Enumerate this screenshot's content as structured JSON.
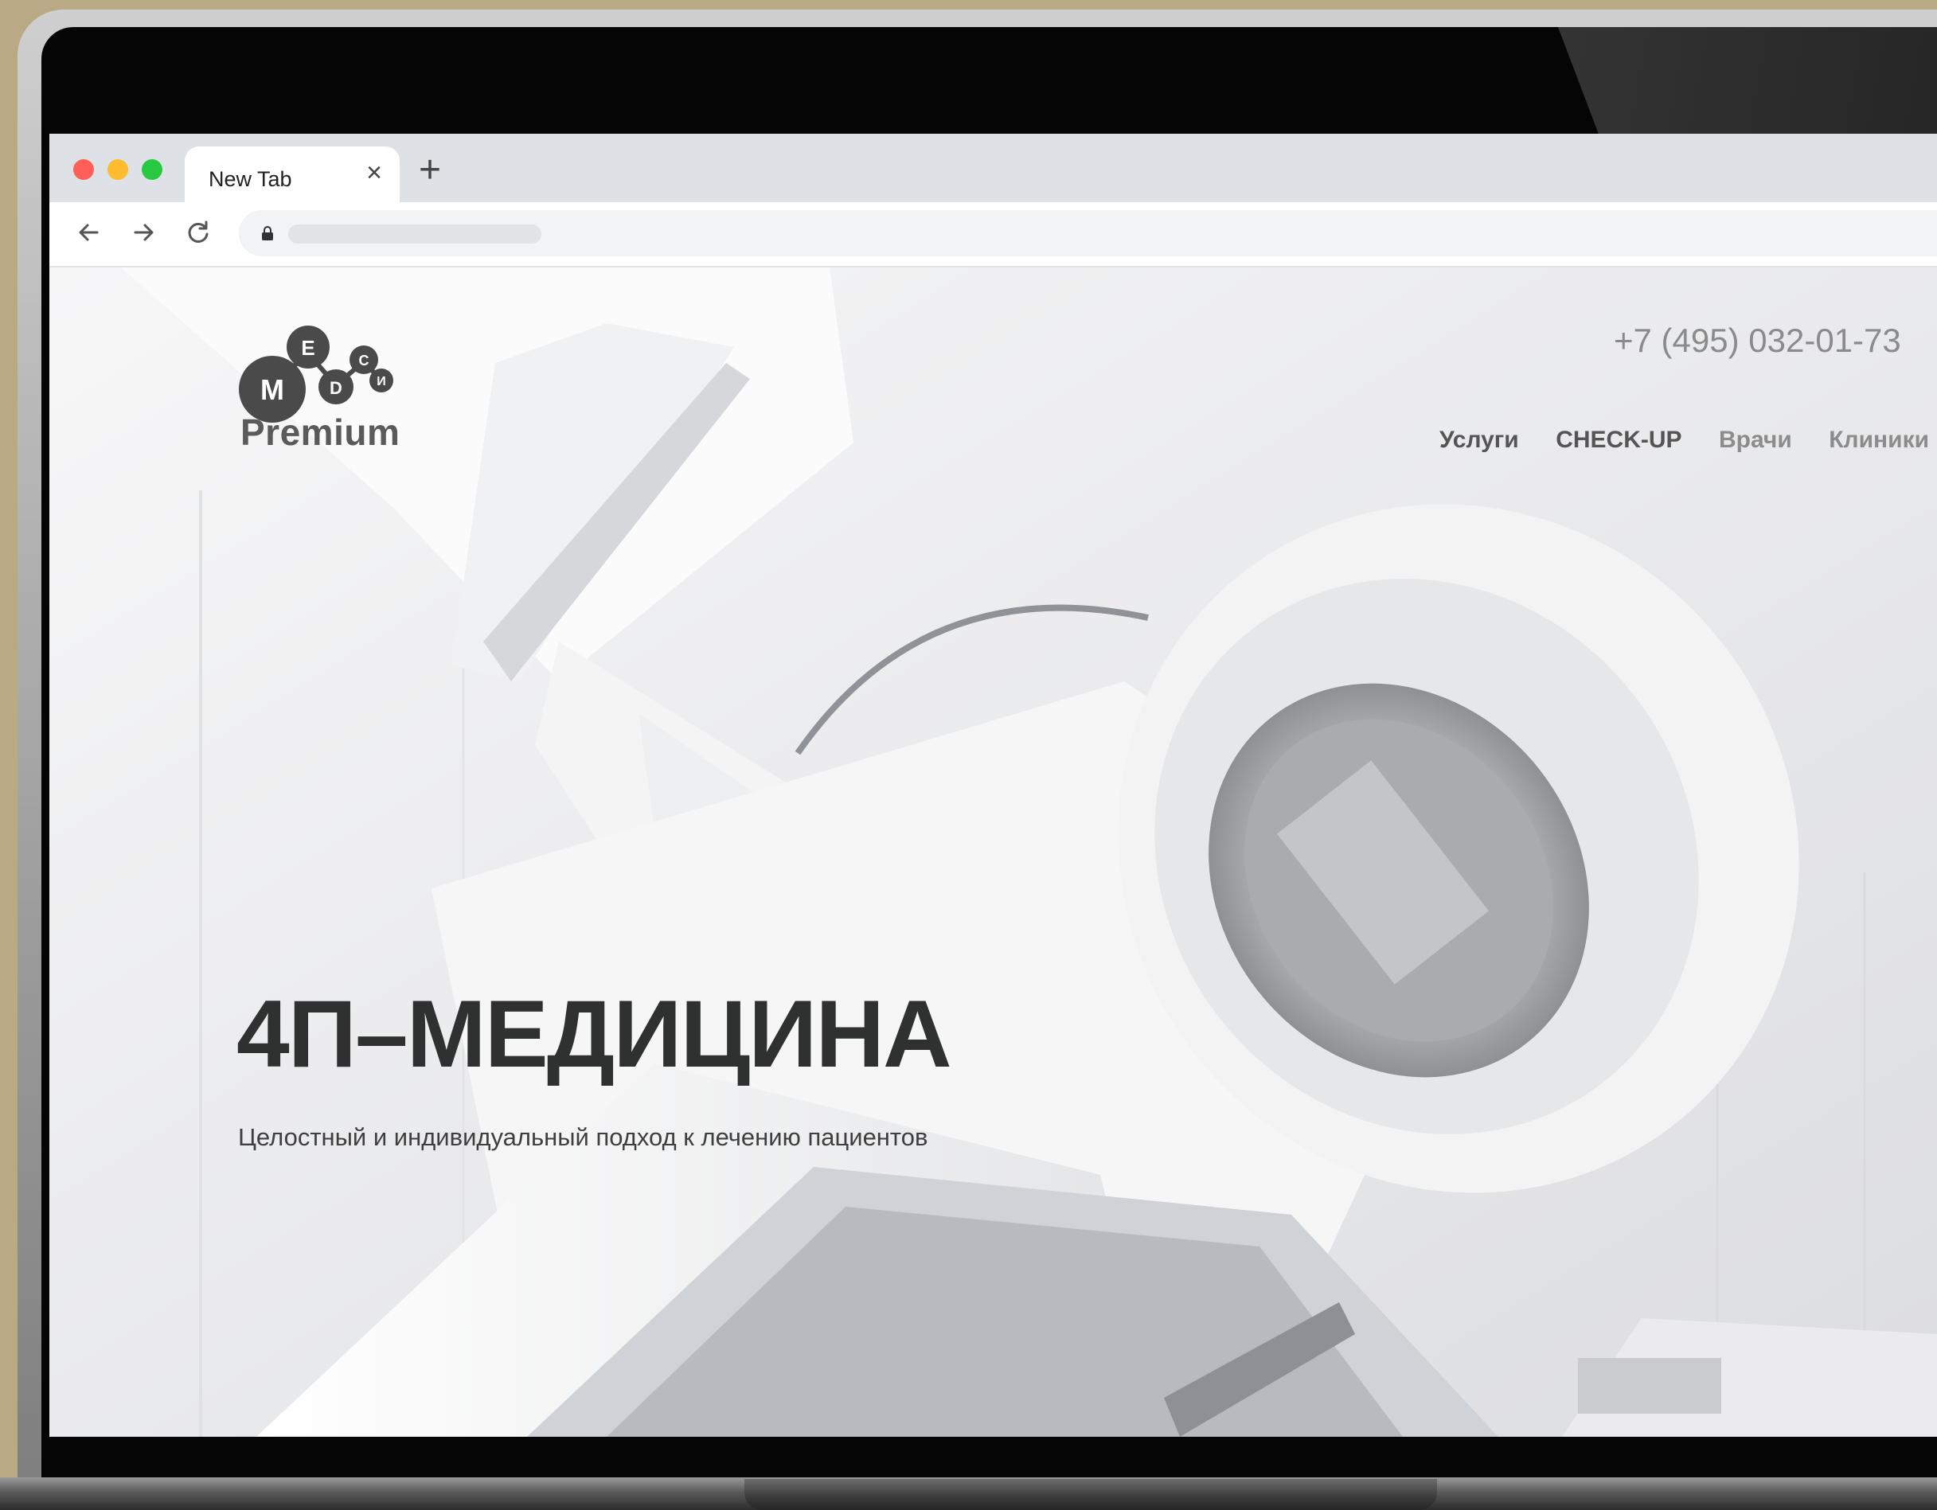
{
  "browser": {
    "tab_title": "New Tab",
    "tab_close": "×",
    "new_tab": "+"
  },
  "site": {
    "logo": {
      "letters": [
        "M",
        "E",
        "D",
        "С",
        "И"
      ],
      "word": "Premium"
    },
    "phone": "+7 (495) 032-01-73",
    "nav": [
      "Услуги",
      "CHECK-UP",
      "Врачи",
      "Клиники"
    ],
    "hero": {
      "title": "4П–МЕДИЦИНА",
      "subtitle": "Целостный и индивидуальный подход к лечению пациентов"
    }
  },
  "colors": {
    "traffic_red": "#ff5f57",
    "traffic_yellow": "#febc2e",
    "traffic_green": "#28c840",
    "logo_dark": "#4a4a4a",
    "headline": "#2f3030"
  },
  "icons": [
    "back-arrow-icon",
    "forward-arrow-icon",
    "reload-icon",
    "lock-icon"
  ]
}
